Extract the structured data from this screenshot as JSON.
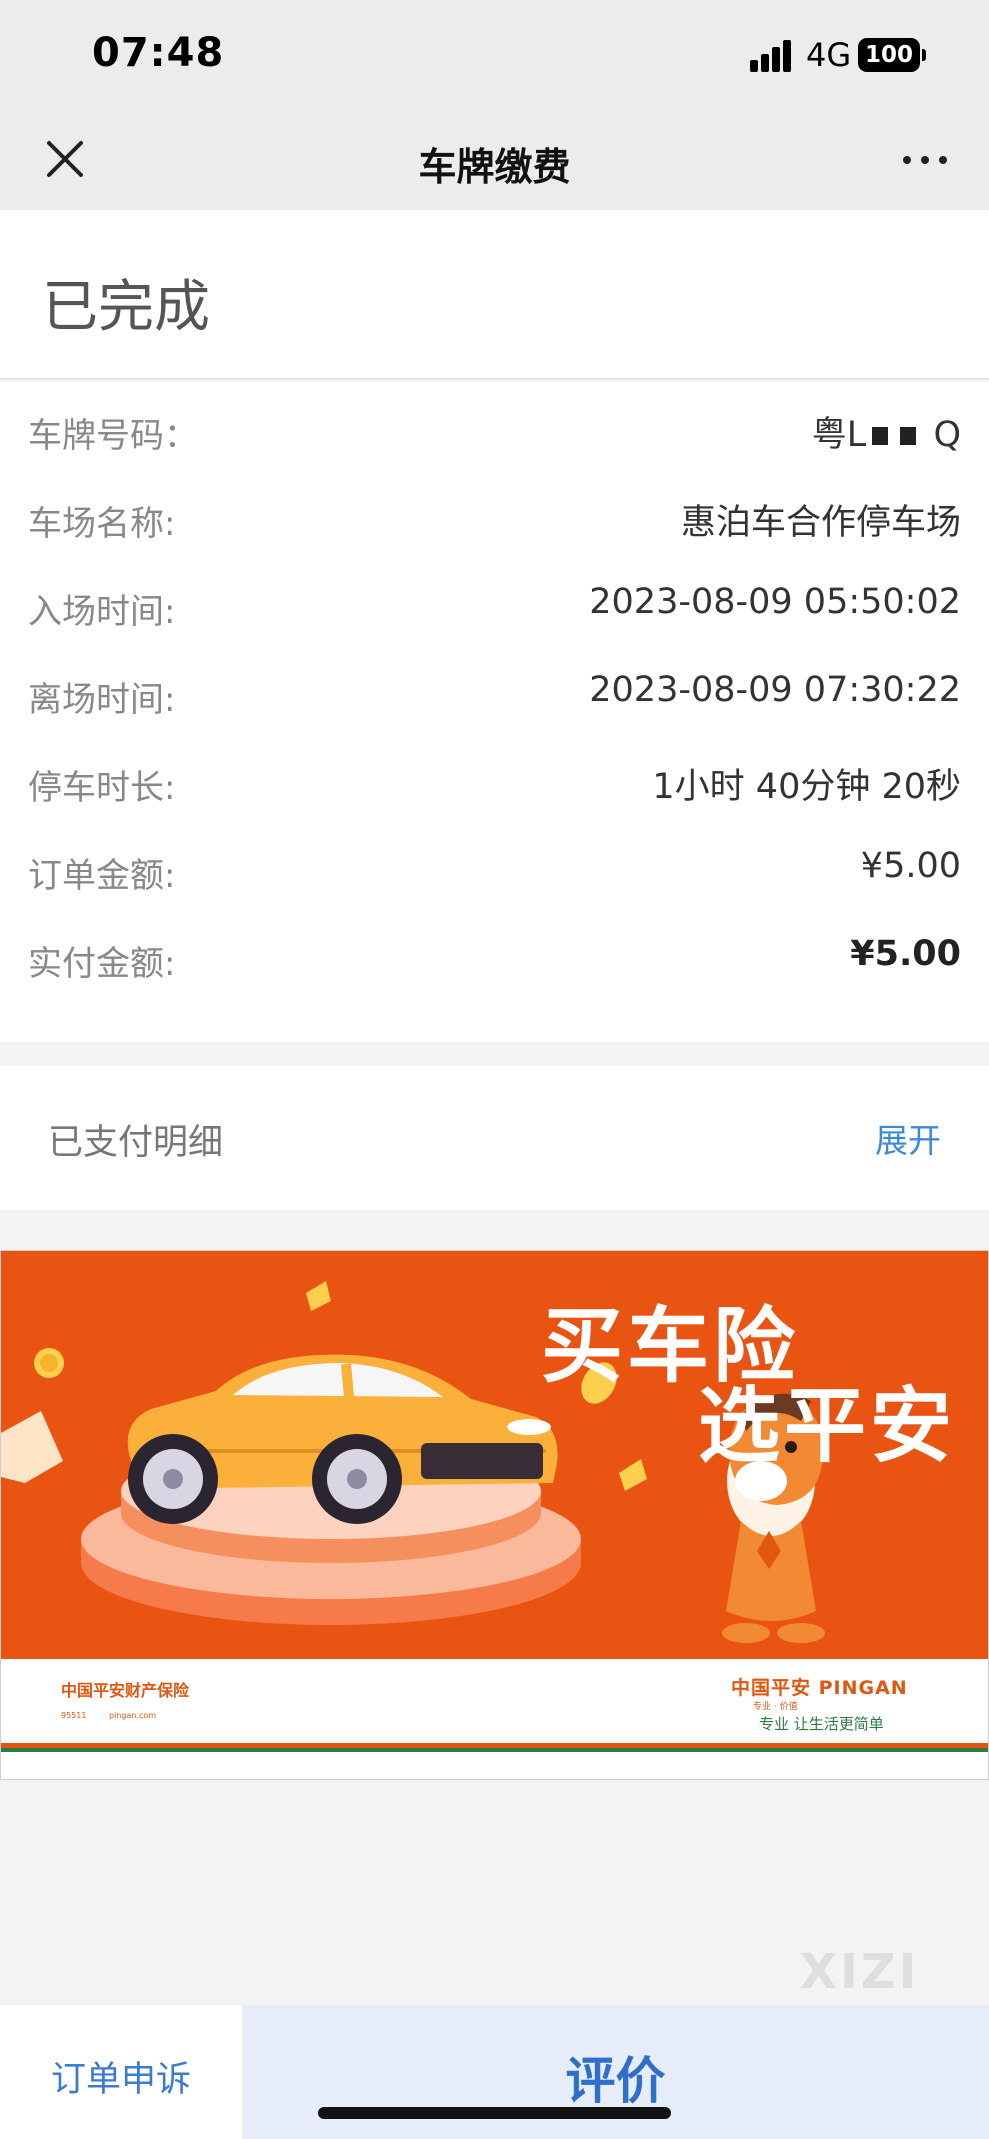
{
  "status_bar": {
    "time": "07:48",
    "network": "4G",
    "battery": "100"
  },
  "nav": {
    "title": "车牌缴费"
  },
  "order_status": "已完成",
  "details": [
    {
      "label": "车牌号码：",
      "value": "粤L",
      "value_suffix": "Q"
    },
    {
      "label": "车场名称:",
      "value": "惠泊车合作停车场"
    },
    {
      "label": "入场时间:",
      "value": "2023-08-09 05:50:02"
    },
    {
      "label": "离场时间:",
      "value": "2023-08-09 07:30:22"
    },
    {
      "label": "停车时长:",
      "value": "1小时 40分钟 20秒"
    },
    {
      "label": "订单金额:",
      "value": "¥5.00"
    },
    {
      "label": "实付金额:",
      "value": "¥5.00"
    }
  ],
  "paid_detail": {
    "label": "已支付明细",
    "expand": "展开"
  },
  "banner": {
    "headline_line1": "买车险",
    "headline_line2": "选平安",
    "company": "中国平安财产保险",
    "contact_1": "95511",
    "contact_2": "pingan.com",
    "brand": "中国平安 PINGAN",
    "brand_sub": "专业 · 价值",
    "slogan": "专业 让生活更简单",
    "accent_color": "#ea5412",
    "secondary_color": "#2c7b45"
  },
  "watermark": "XIZI",
  "bottom_bar": {
    "complain": "订单申诉",
    "rate": "评价"
  },
  "colors": {
    "link": "#3b8ad9",
    "rate_bg": "#e6ecf8"
  }
}
